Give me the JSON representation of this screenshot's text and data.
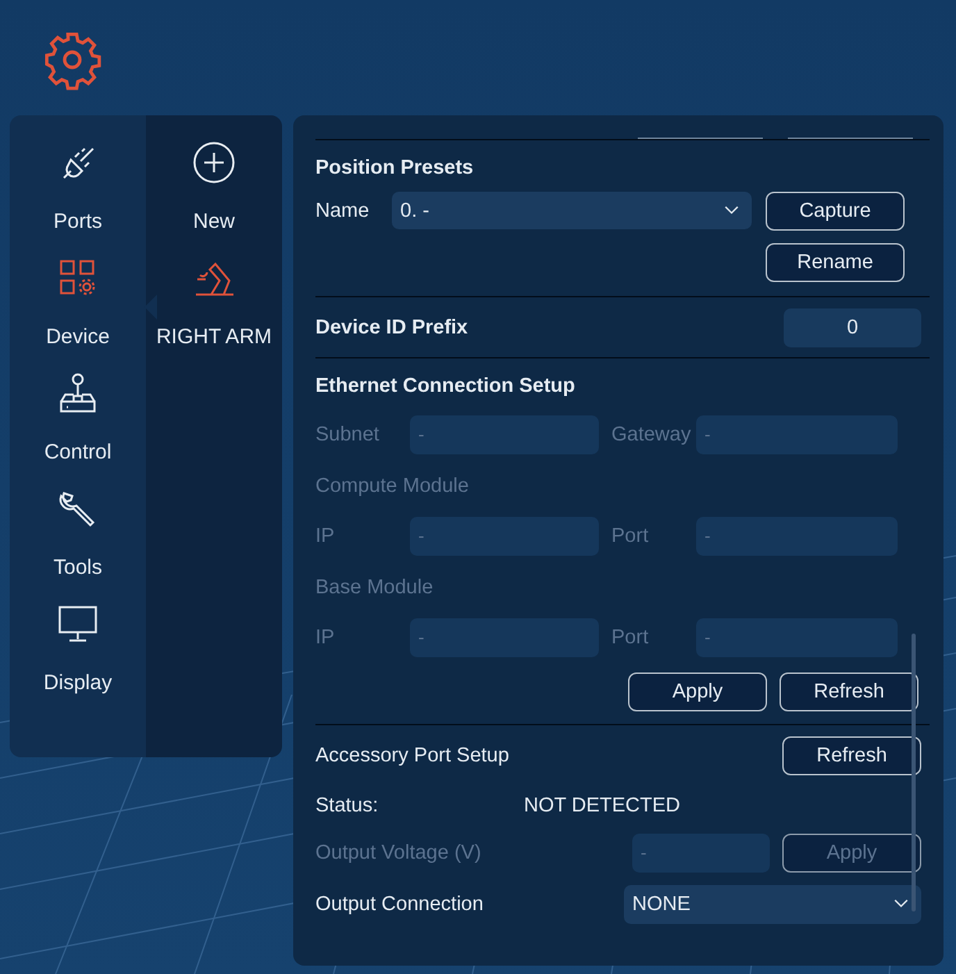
{
  "sidebar": {
    "items": [
      {
        "label": "Ports",
        "selected": false
      },
      {
        "label": "Device",
        "selected": true
      },
      {
        "label": "Control",
        "selected": false
      },
      {
        "label": "Tools",
        "selected": false
      },
      {
        "label": "Display",
        "selected": false
      }
    ]
  },
  "devices": {
    "items": [
      {
        "label": "New",
        "kind": "add",
        "selected": false
      },
      {
        "label": "RIGHT ARM",
        "kind": "device",
        "selected": true
      }
    ]
  },
  "position_presets": {
    "title": "Position Presets",
    "name_label": "Name",
    "value": "0. -",
    "buttons": [
      "Capture",
      "Rename"
    ]
  },
  "device_id_prefix": {
    "label": "Device ID Prefix",
    "value": "0"
  },
  "ethernet": {
    "title": "Ethernet Connection Setup",
    "disabled": true,
    "rows": [
      {
        "kind": "fields",
        "fields": [
          {
            "label": "Subnet",
            "value": "-"
          },
          {
            "label": "Gateway",
            "value": "-"
          }
        ]
      },
      {
        "kind": "heading",
        "label": "Compute Module"
      },
      {
        "kind": "fields",
        "fields": [
          {
            "label": "IP",
            "value": "-"
          },
          {
            "label": "Port",
            "value": "-"
          }
        ]
      },
      {
        "kind": "heading",
        "label": "Base Module"
      },
      {
        "kind": "fields",
        "fields": [
          {
            "label": "IP",
            "value": "-"
          },
          {
            "label": "Port",
            "value": "-"
          }
        ]
      }
    ],
    "buttons": [
      "Apply",
      "Refresh"
    ]
  },
  "accessory": {
    "title": "Accessory Port Setup",
    "button": "Refresh",
    "status_label": "Status:",
    "status": "NOT DETECTED",
    "voltage": {
      "label": "Output Voltage (V)",
      "value": "-",
      "button": "Apply",
      "disabled": true
    },
    "connection": {
      "label": "Output Connection",
      "value": "NONE"
    }
  }
}
